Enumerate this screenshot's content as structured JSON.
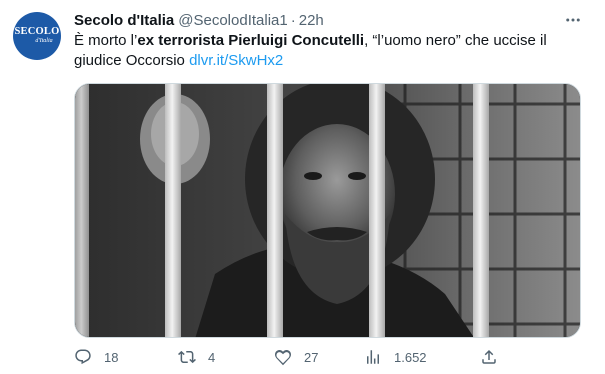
{
  "tweet": {
    "author_name": "Secolo d'Italia",
    "author_handle": "@SecolodItalia1",
    "separator": "·",
    "time": "22h",
    "avatar_logo": "SECOLO",
    "avatar_logo_sub": "d'Italia",
    "text_part1": "È morto l’",
    "text_bold": "ex terrorista Pierluigi Concutelli",
    "text_part2": ", “l’uomo nero” che uccise il giudice Occorsio ",
    "link_text": "dlvr.it/SkwHx2",
    "link_color": "#1d9bf0",
    "media_icon": "photo-prisoner-behind-bars"
  },
  "actions": {
    "reply_count": "18",
    "retweet_count": "4",
    "like_count": "27",
    "views_count": "1.652",
    "reply_icon": "reply-icon",
    "retweet_icon": "retweet-icon",
    "like_icon": "heart-icon",
    "views_icon": "views-icon",
    "share_icon": "share-icon"
  },
  "colors": {
    "text_primary": "#0f1419",
    "text_secondary": "#536471",
    "avatar_bg": "#1d5aa7"
  }
}
